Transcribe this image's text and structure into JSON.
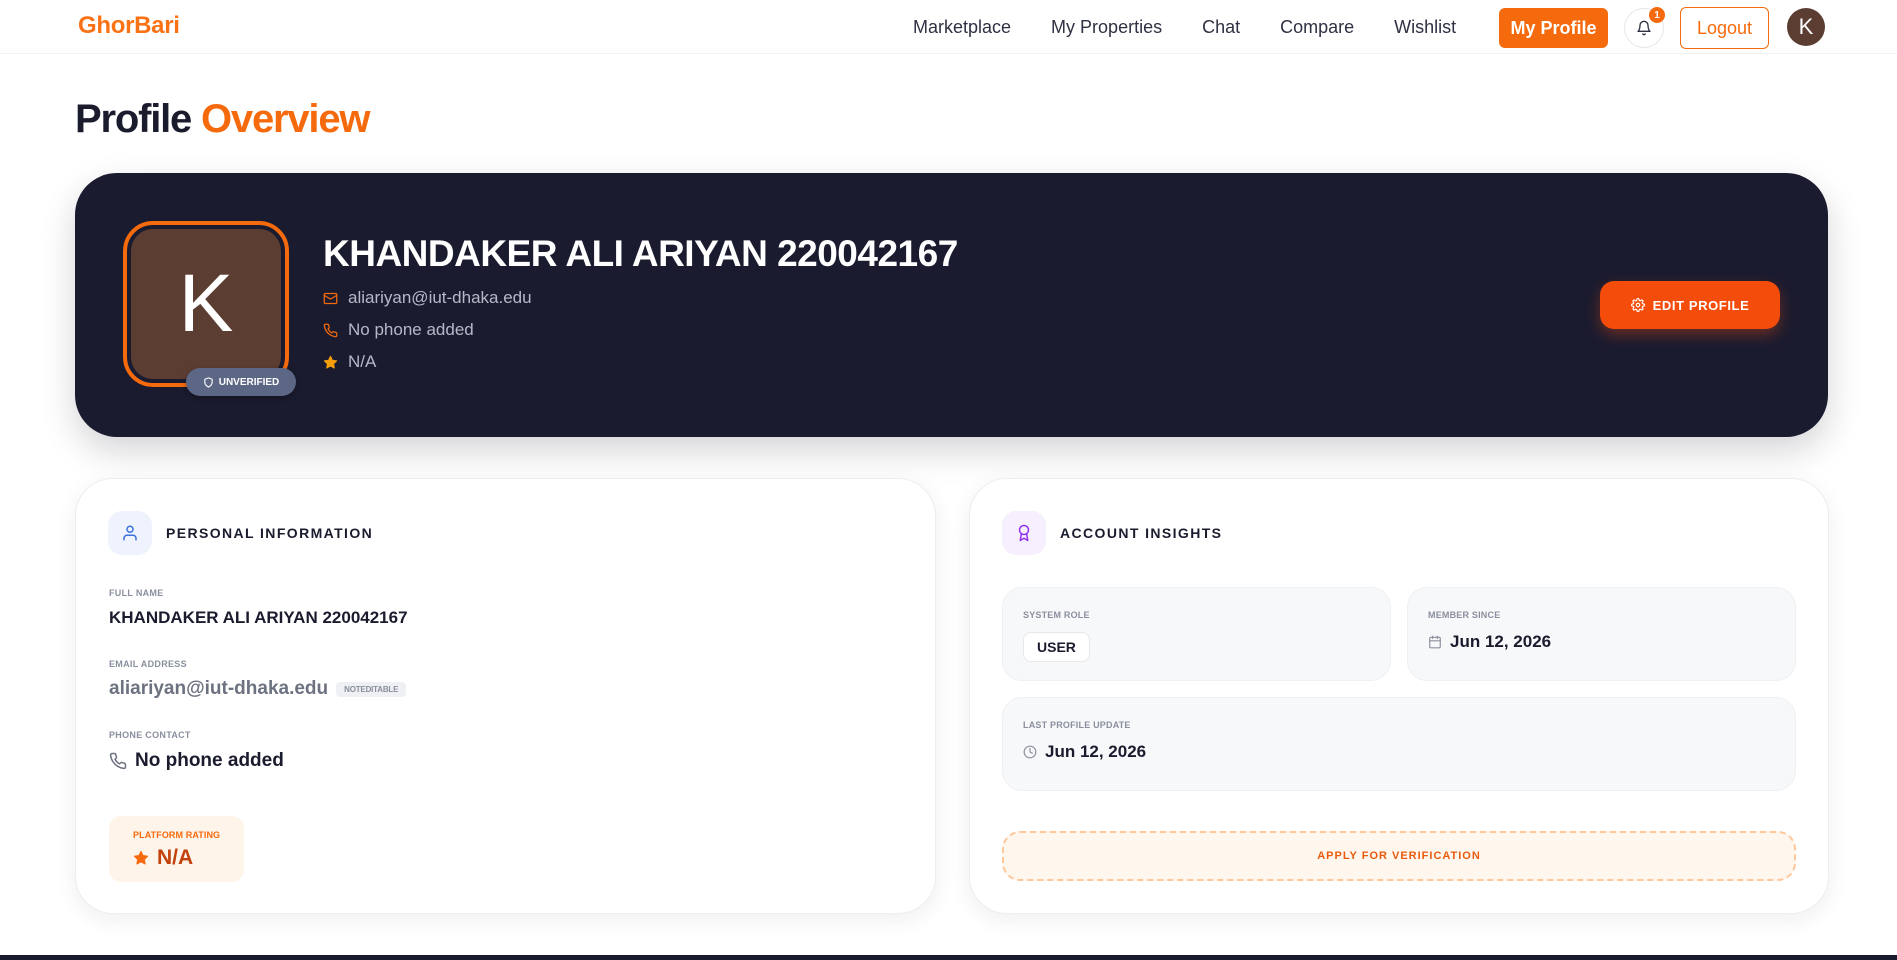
{
  "nav": {
    "logo": "GhorBari",
    "links": [
      "Marketplace",
      "My Properties",
      "Chat",
      "Compare",
      "Wishlist"
    ],
    "my_profile": "My Profile",
    "notification_count": "1",
    "logout": "Logout",
    "avatar_initial": "K"
  },
  "page_title": {
    "part1": "Profile",
    "part2": "Overview"
  },
  "hero": {
    "avatar_initial": "K",
    "badge": "UNVERIFIED",
    "name": "KHANDAKER ALI ARIYAN 220042167",
    "email": "aliariyan@iut-dhaka.edu",
    "phone": "No phone added",
    "rating": "N/A",
    "edit_button": "EDIT PROFILE"
  },
  "personal": {
    "title": "PERSONAL INFORMATION",
    "full_name_label": "FULL NAME",
    "full_name": "KHANDAKER ALI ARIYAN 220042167",
    "email_label": "EMAIL ADDRESS",
    "email": "aliariyan@iut-dhaka.edu",
    "not_editable": "NOTEDITABLE",
    "phone_label": "PHONE CONTACT",
    "phone": "No phone added",
    "rating_label": "PLATFORM RATING",
    "rating": "N/A"
  },
  "insights": {
    "title": "ACCOUNT INSIGHTS",
    "role_label": "SYSTEM ROLE",
    "role": "USER",
    "member_label": "MEMBER SINCE",
    "member_since": "Jun 12, 2026",
    "update_label": "LAST PROFILE UPDATE",
    "last_update": "Jun 12, 2026",
    "apply_button": "APPLY FOR VERIFICATION"
  },
  "colors": {
    "accent": "#f56a0c",
    "dark": "#1b1b2f",
    "avatar": "#5c3d32"
  }
}
